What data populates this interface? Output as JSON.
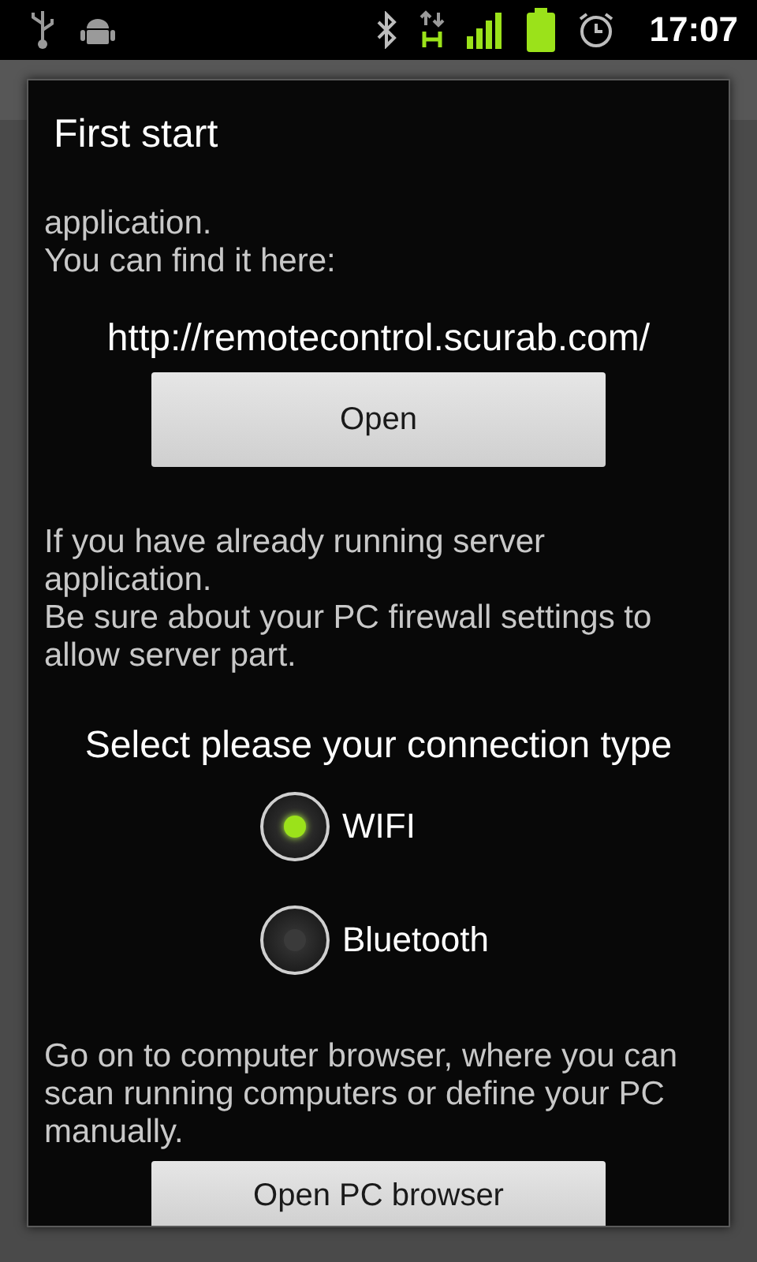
{
  "status_bar": {
    "time": "17:07"
  },
  "dialog": {
    "title": "First start",
    "intro": "application.\nYou can find it here:",
    "url": "http://remotecontrol.scurab.com/",
    "open_button": "Open",
    "server_note": "If you have already running server application.\nBe sure about your PC firewall settings to allow server part.",
    "connection_heading": "Select please your connection type",
    "connection_options": [
      {
        "label": "WIFI",
        "selected": true
      },
      {
        "label": "Bluetooth",
        "selected": false
      }
    ],
    "browser_note": "Go on to computer browser, where you can scan running computers or define your PC manually.",
    "browser_button": "Open PC browser"
  }
}
